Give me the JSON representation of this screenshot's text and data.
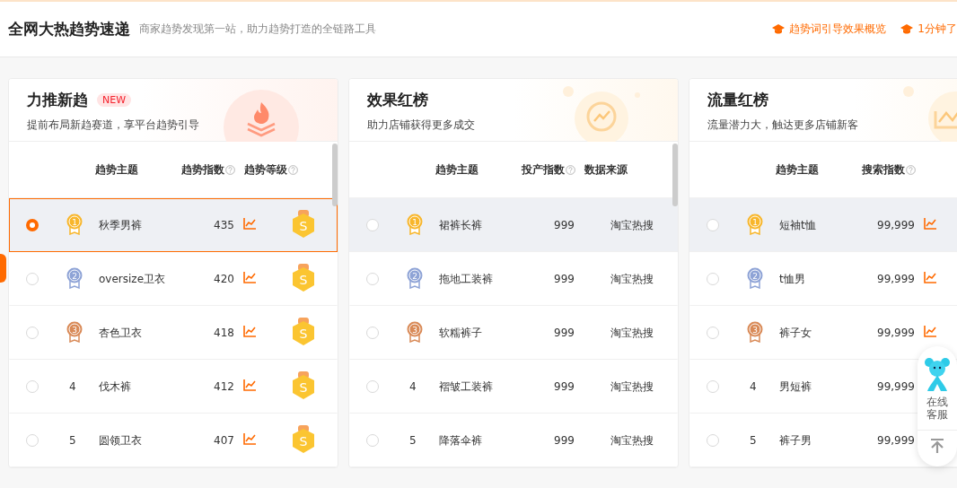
{
  "header": {
    "title": "全网大热趋势速递",
    "subtitle": "商家趋势发现第一站，助力趋势打造的全链路工具",
    "links": [
      "趋势词引导效果概览",
      "1分钟了"
    ]
  },
  "panels": [
    {
      "kind": "flame",
      "title": "力推新趋",
      "badge": "NEW",
      "subtitle": "提前布局新趋赛道，享平台趋势引导",
      "columns": [
        {
          "label": "趋势主题",
          "help": false
        },
        {
          "label": "趋势指数",
          "help": true
        },
        {
          "label": "趋势等级",
          "help": true
        }
      ],
      "rows": [
        {
          "rank": "1",
          "color": "#f8b62b",
          "topic": "秋季男裤",
          "index": "435",
          "trend": true,
          "level": "S",
          "selected": true,
          "highlighted": true
        },
        {
          "rank": "2",
          "color": "#8ea3d6",
          "topic": "oversize卫衣",
          "index": "420",
          "trend": true,
          "level": "S",
          "selected": false,
          "highlighted": false
        },
        {
          "rank": "3",
          "color": "#d98a57",
          "topic": "杏色卫衣",
          "index": "418",
          "trend": true,
          "level": "S",
          "selected": false,
          "highlighted": false
        },
        {
          "rank": "4",
          "topic": "伐木裤",
          "index": "412",
          "trend": true,
          "level": "S",
          "selected": false,
          "highlighted": false
        },
        {
          "rank": "5",
          "topic": "圆领卫衣",
          "index": "407",
          "trend": true,
          "level": "S",
          "selected": false,
          "highlighted": false
        }
      ]
    },
    {
      "kind": "chart",
      "title": "效果红榜",
      "subtitle": "助力店铺获得更多成交",
      "columns": [
        {
          "label": "趋势主题",
          "help": false
        },
        {
          "label": "投产指数",
          "help": true
        },
        {
          "label": "数据来源",
          "help": false
        }
      ],
      "rows": [
        {
          "rank": "1",
          "color": "#f8b62b",
          "topic": "裙裤长裤",
          "index": "999",
          "trend": false,
          "source": "淘宝热搜",
          "selected": false,
          "highlighted": true
        },
        {
          "rank": "2",
          "color": "#8ea3d6",
          "topic": "拖地工装裤",
          "index": "999",
          "trend": false,
          "source": "淘宝热搜",
          "selected": false,
          "highlighted": false
        },
        {
          "rank": "3",
          "color": "#d98a57",
          "topic": "软糯裤子",
          "index": "999",
          "trend": false,
          "source": "淘宝热搜",
          "selected": false,
          "highlighted": false
        },
        {
          "rank": "4",
          "topic": "褶皱工装裤",
          "index": "999",
          "trend": false,
          "source": "淘宝热搜",
          "selected": false,
          "highlighted": false
        },
        {
          "rank": "5",
          "topic": "降落伞裤",
          "index": "999",
          "trend": false,
          "source": "淘宝热搜",
          "selected": false,
          "highlighted": false
        }
      ]
    },
    {
      "kind": "wave",
      "title": "流量红榜",
      "subtitle": "流量潜力大，触达更多店铺新客",
      "columns": [
        {
          "label": "趋势主题",
          "help": false
        },
        {
          "label": "搜索指数",
          "help": true
        }
      ],
      "rows": [
        {
          "rank": "1",
          "color": "#f8b62b",
          "topic": "短袖t恤",
          "index": "99,999",
          "trend": true,
          "selected": false,
          "highlighted": true
        },
        {
          "rank": "2",
          "color": "#8ea3d6",
          "topic": "t恤男",
          "index": "99,999",
          "trend": true,
          "selected": false,
          "highlighted": false
        },
        {
          "rank": "3",
          "color": "#d98a57",
          "topic": "裤子女",
          "index": "99,999",
          "trend": true,
          "selected": false,
          "highlighted": false
        },
        {
          "rank": "4",
          "topic": "男短裤",
          "index": "99,999",
          "trend": false,
          "selected": false,
          "highlighted": false
        },
        {
          "rank": "5",
          "topic": "裤子男",
          "index": "99,999",
          "trend": false,
          "selected": false,
          "highlighted": false
        }
      ]
    }
  ],
  "service": {
    "label": "在线客服"
  }
}
